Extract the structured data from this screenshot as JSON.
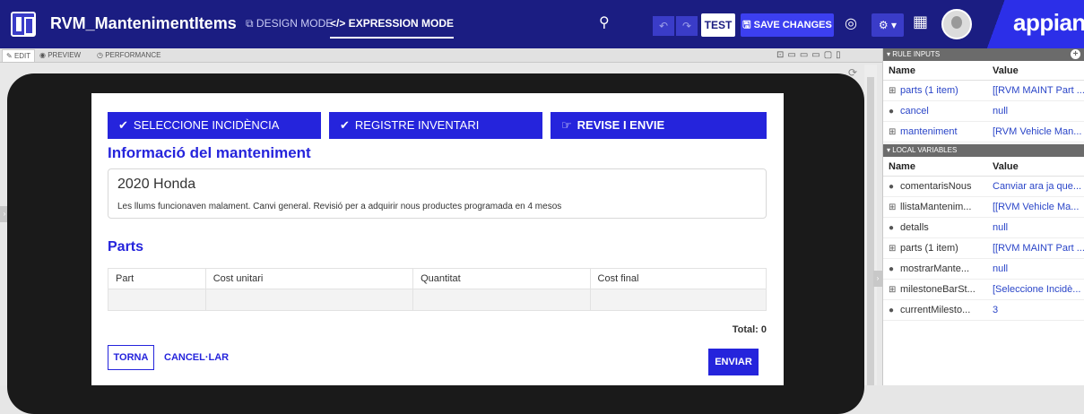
{
  "header": {
    "title": "RVM_MantenimentItems",
    "design_mode": "DESIGN MODE",
    "expression_mode": "</> EXPRESSION MODE",
    "test_label": "TEST",
    "save_label": "SAVE CHANGES",
    "logo_text": "appian"
  },
  "subbar": {
    "edit": "EDIT",
    "preview": "PREVIEW",
    "performance": "PERFORMANCE"
  },
  "milestones": [
    {
      "label": "SELECCIONE INCIDÈNCIA",
      "icon": "check-icon"
    },
    {
      "label": "REGISTRE INVENTARI",
      "icon": "check-icon"
    },
    {
      "label": "REVISE I ENVIE",
      "icon": "thumbs-up-icon"
    }
  ],
  "info": {
    "title": "Informació del manteniment",
    "vehicle": "2020 Honda",
    "description": "Les llums funcionaven malament. Canvi general. Revisió per a adquirir nous productes programada en 4 mesos"
  },
  "parts": {
    "title": "Parts",
    "columns": [
      "Part",
      "Cost unitari",
      "Quantitat",
      "Cost final"
    ],
    "total": "Total: 0"
  },
  "actions": {
    "back": "TORNA",
    "cancel": "CANCEL·LAR",
    "send": "ENVIAR"
  },
  "rule_inputs": {
    "heading": "RULE INPUTS",
    "name_col": "Name",
    "value_col": "Value",
    "rows": [
      {
        "name": "parts (1 item)",
        "value": "[[RVM MAINT Part ...",
        "expand": true
      },
      {
        "name": "cancel",
        "value": "null",
        "expand": false
      },
      {
        "name": "manteniment",
        "value": "[RVM Vehicle Man...",
        "expand": true
      }
    ]
  },
  "local_variables": {
    "heading": "LOCAL VARIABLES",
    "name_col": "Name",
    "value_col": "Value",
    "rows": [
      {
        "name": "comentarisNous",
        "value": "Canviar ara ja que...",
        "expand": false
      },
      {
        "name": "llistaMantenim...",
        "value": "[[RVM Vehicle Ma...",
        "expand": true
      },
      {
        "name": "detalls",
        "value": "null",
        "expand": false
      },
      {
        "name": "parts (1 item)",
        "value": "[[RVM MAINT Part ...",
        "expand": true
      },
      {
        "name": "mostrarMante...",
        "value": "null",
        "expand": false
      },
      {
        "name": "milestoneBarSt...",
        "value": "[Seleccione Incidè...",
        "expand": true
      },
      {
        "name": "currentMilesto...",
        "value": "3",
        "expand": false
      }
    ]
  }
}
